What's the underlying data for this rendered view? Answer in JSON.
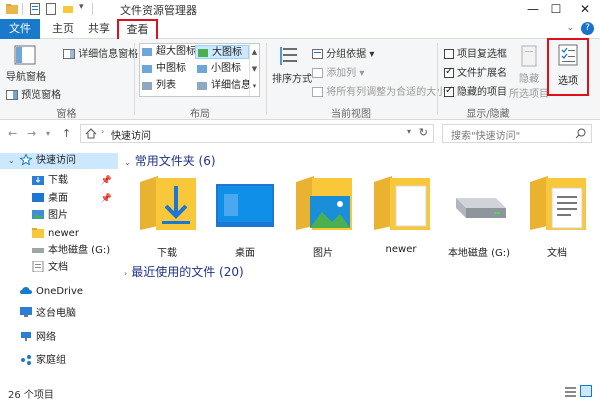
{
  "window": {
    "title": "文件资源管理器",
    "minimize": "—",
    "maximize": "☐",
    "close": "✕"
  },
  "tabs": [
    {
      "label": "文件"
    },
    {
      "label": "主页"
    },
    {
      "label": "共享"
    },
    {
      "label": "查看"
    }
  ],
  "ribbon": {
    "pane": {
      "nav_pane": "导航窗格",
      "preview_pane": "预览窗格",
      "details_pane": "详细信息窗格",
      "group": "窗格"
    },
    "layout": {
      "items": [
        "超大图标",
        "大图标",
        "中图标",
        "小图标",
        "列表",
        "详细信息"
      ],
      "selected": "大图标",
      "group": "布局"
    },
    "current_view": {
      "sort_by": "排序方式",
      "group_by": "分组依据",
      "add_columns": "添加列",
      "size_all_columns": "将所有列调整为合适的大小",
      "group": "当前视图"
    },
    "show_hide": {
      "item_checkboxes": {
        "label": "项目复选框",
        "checked": false
      },
      "file_extensions": {
        "label": "文件扩展名",
        "checked": true
      },
      "hidden_items": {
        "label": "隐藏的项目",
        "checked": true
      },
      "hide": "隐藏",
      "hide_selected": "所选项目",
      "group": "显示/隐藏"
    },
    "options": "选项"
  },
  "address": {
    "path": "快速访问",
    "search_placeholder": "搜索\"快速访问\""
  },
  "nav_pane": {
    "quick_access": "快速访问",
    "quick_items": [
      "下载",
      "桌面",
      "图片",
      "newer",
      "本地磁盘 (G:)",
      "文档"
    ],
    "onedrive": "OneDrive",
    "this_pc": "这台电脑",
    "network": "网络",
    "homegroup": "家庭组"
  },
  "content": {
    "frequent_header": "常用文件夹 (6)",
    "folders": [
      "下载",
      "桌面",
      "图片",
      "newer",
      "本地磁盘 (G:)",
      "文档"
    ],
    "recent_header": "最近使用的文件 (20)"
  },
  "status": {
    "count": "26 个项目"
  },
  "colors": {
    "accent": "#1979ca",
    "highlight_box": "#e0101b",
    "selection": "#cce8ff",
    "folder": "#f8c73a"
  }
}
